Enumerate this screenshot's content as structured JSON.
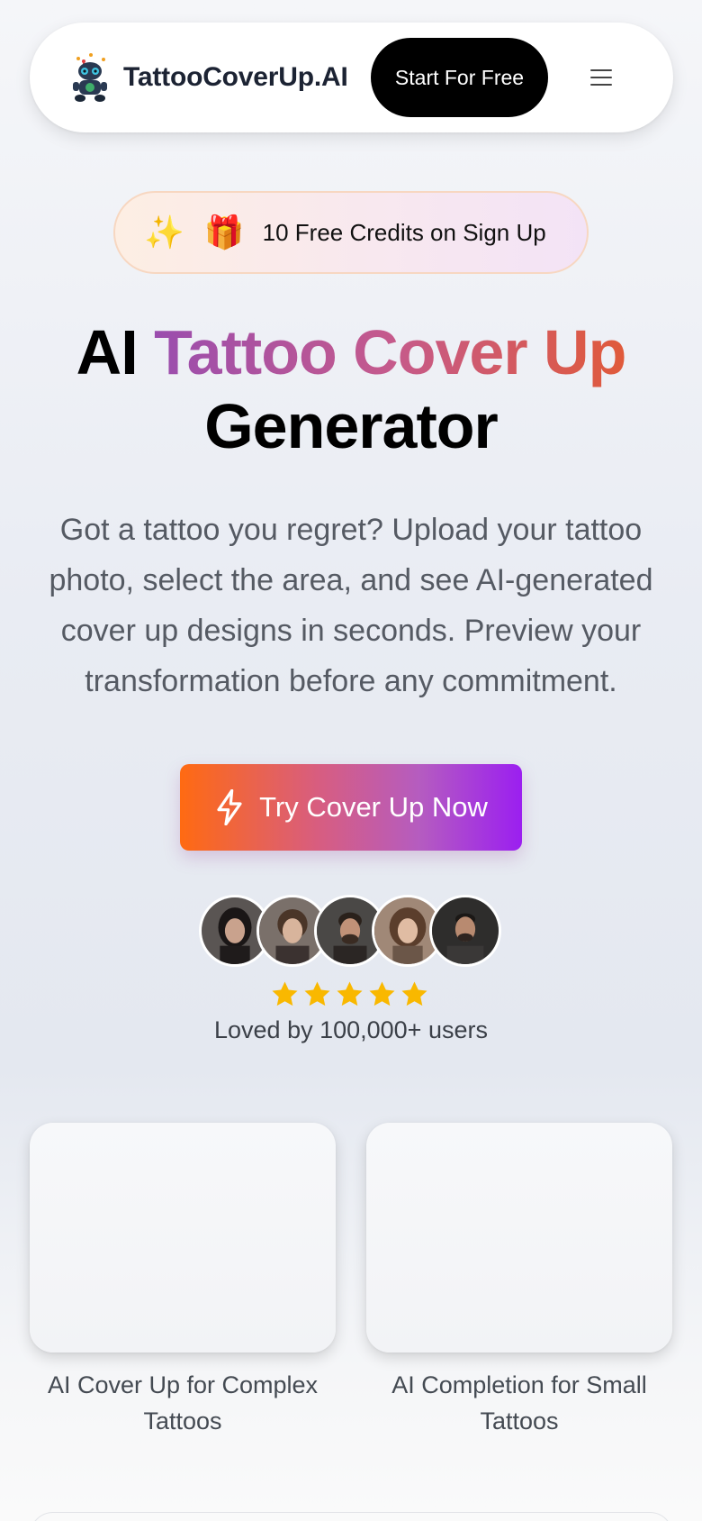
{
  "header": {
    "brand": "TattooCoverUp.AI",
    "start_label": "Start For Free",
    "menu_icon": "hamburger-menu-icon"
  },
  "badge": {
    "icons": [
      "sparkles-icon",
      "gift-icon"
    ],
    "text": "10 Free Credits on Sign Up"
  },
  "hero": {
    "title_part1": "AI",
    "title_highlight": "Tattoo Cover Up",
    "title_part2": "Generator",
    "subtitle": "Got a tattoo you regret? Upload your tattoo photo, select the area, and see AI-generated cover up designs in seconds. Preview your transformation before any commitment.",
    "cta_label": "Try Cover Up Now",
    "cta_icon": "lightning-icon"
  },
  "social_proof": {
    "avatar_count": 5,
    "rating": 5,
    "text": "Loved by 100,000+ users"
  },
  "features": [
    {
      "label": "AI Cover Up for Complex Tattoos"
    },
    {
      "label": "AI Completion for Small Tattoos"
    }
  ],
  "colors": {
    "title_gradient": [
      "#9a4dae",
      "#c55a8c",
      "#e05a3a"
    ],
    "cta_gradient": [
      "#ff6a12",
      "#d85d7f",
      "#9b1ff0"
    ],
    "star": "#f9b800"
  }
}
